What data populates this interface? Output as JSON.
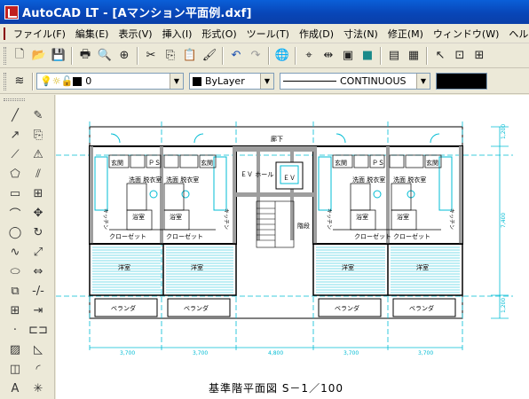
{
  "window": {
    "title": "AutoCAD LT - [Aマンション平面例.dxf]"
  },
  "menu": [
    "ファイル(F)",
    "編集(E)",
    "表示(V)",
    "挿入(I)",
    "形式(O)",
    "ツール(T)",
    "作成(D)",
    "寸法(N)",
    "修正(M)",
    "ウィンドウ(W)",
    "ヘルプ"
  ],
  "toolbar_icons": [
    "new-icon",
    "open-icon",
    "save-icon",
    "print-icon",
    "print-preview-icon",
    "plot-icon",
    "cut-icon",
    "copy-icon",
    "paste-icon",
    "match-properties-icon",
    "undo-icon",
    "redo-icon",
    "internet-icon",
    "snap-icon",
    "dist-icon",
    "pan-icon",
    "zoom-icon",
    "properties-icon",
    "designcenter-icon",
    "help-icon"
  ],
  "properties": {
    "layer_value": "0",
    "color_value": "ByLayer",
    "linetype_value": "CONTINUOUS",
    "lineweight_value": ""
  },
  "draw_tools": [
    "line-icon",
    "ray-icon",
    "pline-icon",
    "polygon-icon",
    "rectangle-icon",
    "arc-icon",
    "circle-icon",
    "spline-icon",
    "ellipse-icon",
    "insert-block-icon",
    "make-block-icon",
    "point-icon",
    "hatch-icon",
    "region-icon",
    "text-icon"
  ],
  "modify_tools": [
    "erase-icon",
    "copy-object-icon",
    "mirror-icon",
    "offset-icon",
    "array-icon",
    "move-icon",
    "rotate-icon",
    "scale-icon",
    "stretch-icon",
    "trim-icon",
    "extend-icon",
    "break-icon",
    "chamfer-icon",
    "fillet-icon",
    "explode-icon"
  ],
  "drawing": {
    "caption": "基準階平面図 S－1／100",
    "labels": {
      "corridor": "廊下",
      "ev_hall": "ＥＶ\nホール",
      "ev": "ＥＶ",
      "stairs": "階段",
      "entrance": "玄関",
      "ps": "ＰＳ",
      "washroom": "洗面\n脱衣室",
      "bath": "浴室",
      "kitchen": "キッチン",
      "closet": "クローゼット",
      "room": "洋室",
      "veranda": "ベランダ"
    },
    "dimensions_horizontal": [
      "3,700",
      "3,700",
      "4,800",
      "3,700",
      "3,700"
    ],
    "dimensions_vertical": [
      "1,200",
      "7,400",
      "1,200"
    ]
  }
}
